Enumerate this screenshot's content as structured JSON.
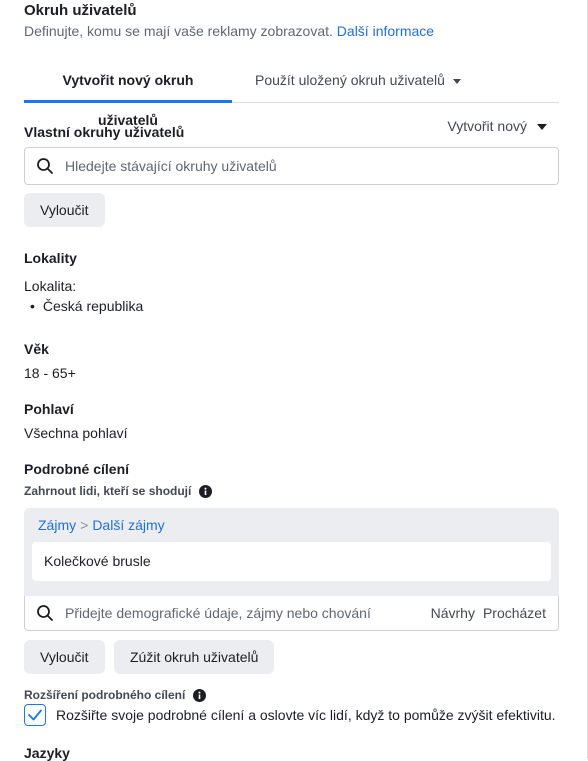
{
  "header": {
    "title": "Okruh uživatelů",
    "subtitle": "Definujte, komu se mají vaše reklamy zobrazovat.",
    "more_info_link": "Další informace"
  },
  "tabs": [
    {
      "label": "Vytvořit nový okruh uživatelů",
      "active": true
    },
    {
      "label": "Použít uložený okruh uživatelů",
      "active": false
    }
  ],
  "custom_audiences": {
    "label": "Vlastní okruhy uživatelů",
    "create_dropdown": "Vytvořit nový",
    "search_placeholder": "Hledejte stávající okruhy uživatelů",
    "exclude_button": "Vyloučit"
  },
  "locations": {
    "label": "Lokality",
    "sublabel": "Lokalita:",
    "items": [
      "Česká republika"
    ]
  },
  "age": {
    "label": "Věk",
    "value": "18 - 65+"
  },
  "gender": {
    "label": "Pohlaví",
    "value": "Všechna pohlaví"
  },
  "detailed_targeting": {
    "label": "Podrobné cílení",
    "include_label": "Zahrnout lidi, kteří se shodují",
    "breadcrumb": [
      "Zájmy",
      "Další zájmy"
    ],
    "breadcrumb_separator": ">",
    "selected_items": [
      "Kolečkové brusle"
    ],
    "search_placeholder": "Přidejte demografické údaje, zájmy nebo chování",
    "suggestions_link": "Návrhy",
    "browse_link": "Procházet",
    "exclude_button": "Vyloučit",
    "narrow_button": "Zúžit okruh uživatelů"
  },
  "expansion": {
    "label": "Rozšíření podrobného cílení",
    "checked": true,
    "text": "Rozšiřte svoje podrobné cílení a oslovte víc lidí, když to pomůže zvýšit efektivitu."
  },
  "languages": {
    "label": "Jazyky"
  },
  "colors": {
    "accent": "#1877f2",
    "link": "#216fdb"
  }
}
